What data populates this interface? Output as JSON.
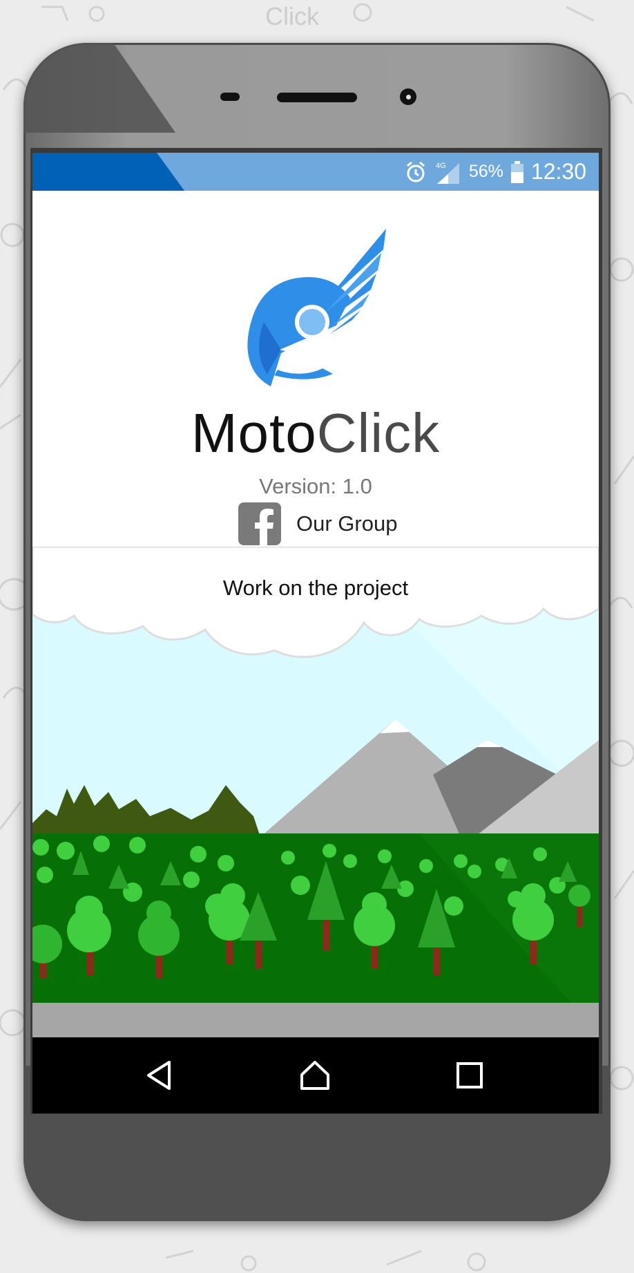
{
  "status_bar": {
    "network_label": "4G",
    "battery_percent": "56%",
    "time": "12:30",
    "icons": [
      "alarm-icon",
      "signal-icon",
      "battery-icon"
    ]
  },
  "app": {
    "title_part1": "Moto",
    "title_part2": "Click",
    "version_label": "Version:",
    "version_value": "1.0",
    "group_link_label": "Our Group",
    "work_text": "Work on the project"
  },
  "navigation": {
    "buttons": [
      "back",
      "home",
      "recents"
    ]
  },
  "colors": {
    "status_bar": "#6fa8dc",
    "status_bar_dark": "#0061b5",
    "logo_blue": "#2f8fe8",
    "sky": "#d9fbff",
    "forest": "#067006",
    "tree_light": "#3fcf3f",
    "road": "#a6a6a6"
  }
}
